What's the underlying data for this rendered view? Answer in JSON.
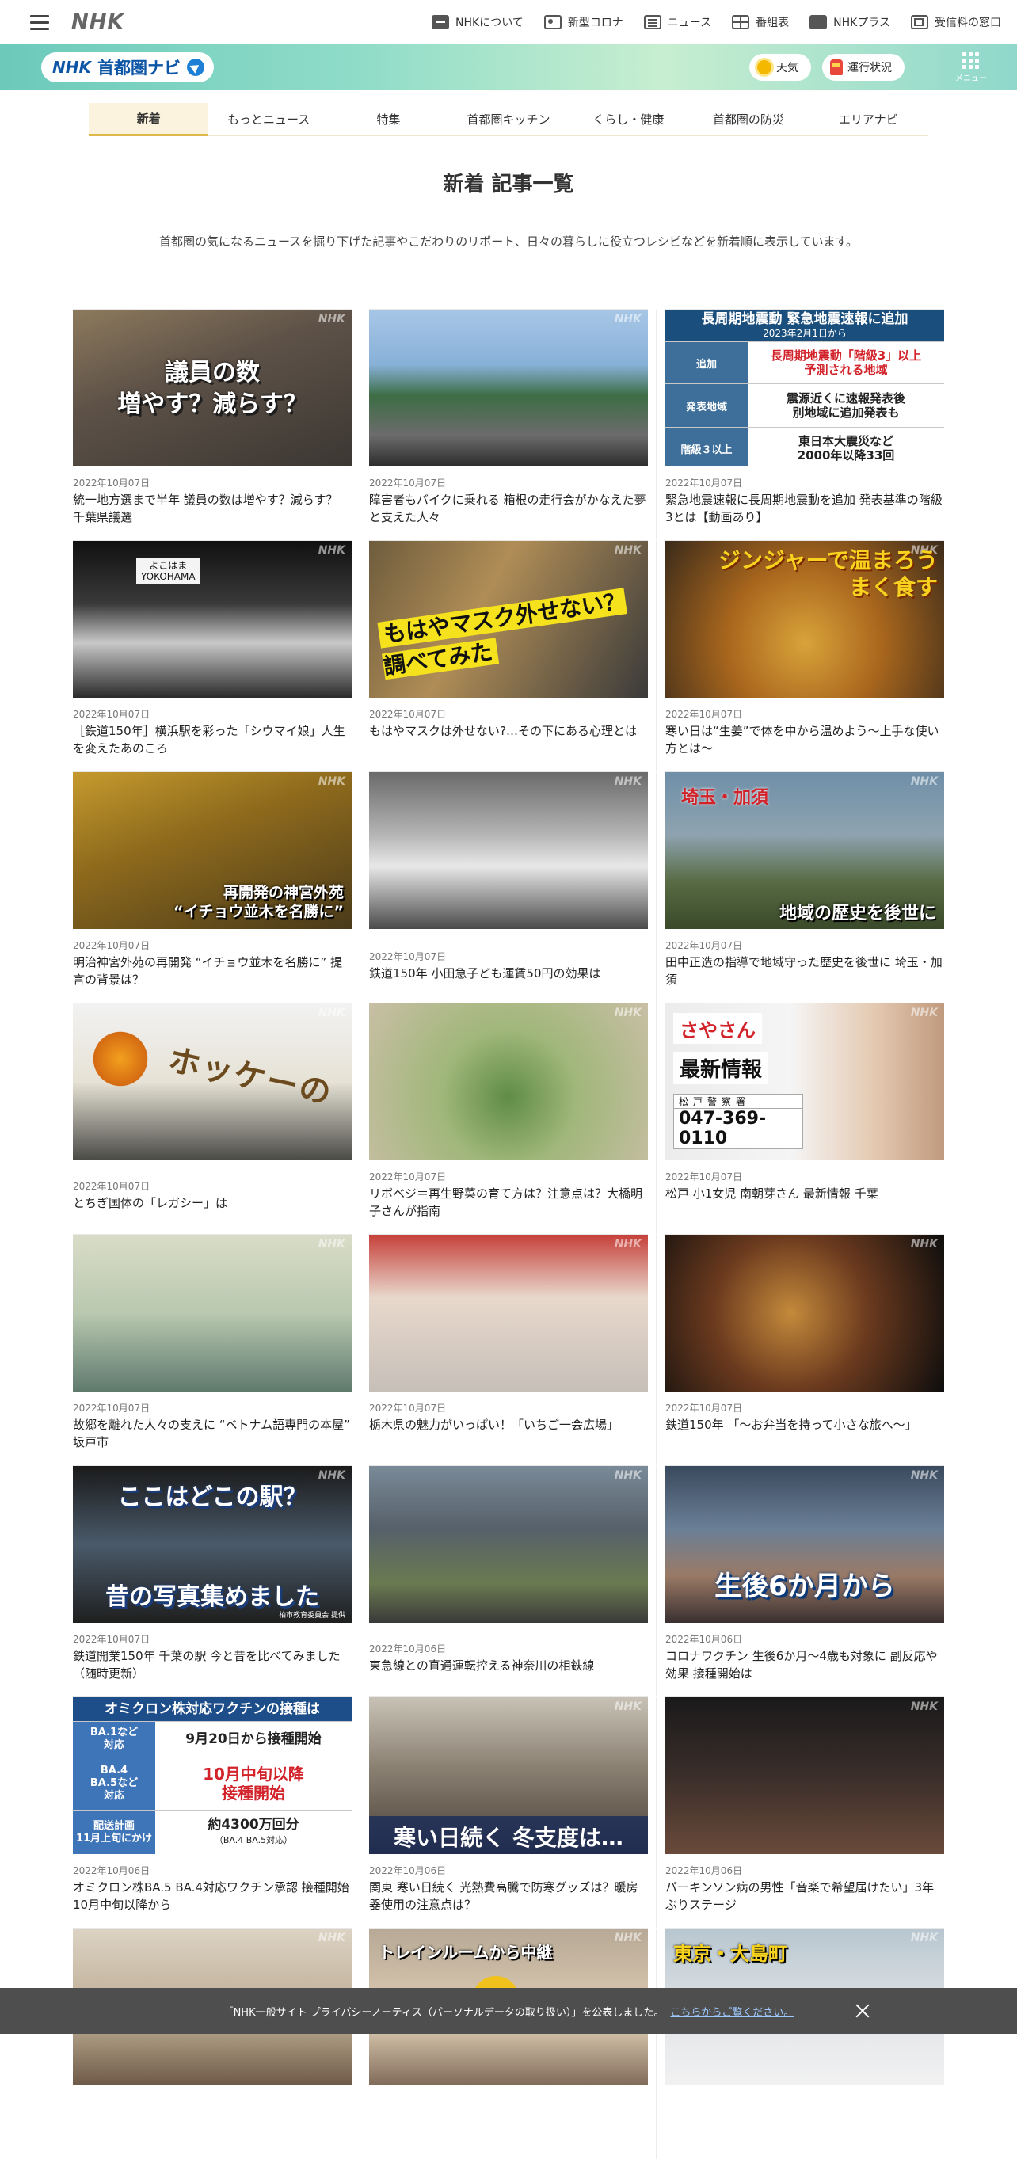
{
  "global_nav": {
    "logo": "NHK",
    "links": [
      {
        "label": "NHKについて",
        "icon": "nhk-icon"
      },
      {
        "label": "新型コロナ",
        "icon": "corona-icon"
      },
      {
        "label": "ニュース",
        "icon": "news-icon"
      },
      {
        "label": "番組表",
        "icon": "program-guide-icon"
      },
      {
        "label": "NHKプラス",
        "icon": "nhk-plus-icon"
      },
      {
        "label": "受信料の窓口",
        "icon": "license-fee-icon"
      }
    ]
  },
  "region_header": {
    "logo_nhk": "NHK",
    "logo_name": "首都圏ナビ",
    "weather_label": "天気",
    "traffic_label": "運行状況",
    "menu_label": "メニュー"
  },
  "tabs": [
    {
      "label": "新着",
      "active": true
    },
    {
      "label": "もっとニュース",
      "active": false
    },
    {
      "label": "特集",
      "active": false
    },
    {
      "label": "首都圏キッチン",
      "active": false
    },
    {
      "label": "くらし・健康",
      "active": false
    },
    {
      "label": "首都圏の防災",
      "active": false
    },
    {
      "label": "エリアナビ",
      "active": false
    }
  ],
  "page": {
    "title": "新着 記事一覧",
    "description": "首都圏の気になるニュースを掘り下げた記事やこだわりのリポート、日々の暮らしに役立つレシピなどを新着順に表示しています。"
  },
  "thumbnail_texts": {
    "watermark": "NHK",
    "giin": "議員の数\n増やす？減らす？",
    "eq_title": "長周期地震動 緊急地震速報に追加",
    "eq_date": "2023年2月1日から",
    "eq_rows": [
      {
        "key": "追加",
        "value": "長周期地震動「階級3」以上\n予測される地域"
      },
      {
        "key": "発表地域",
        "value": "震源近くに速報発表後\n別地域に追加発表も"
      },
      {
        "key": "階級３以上",
        "value": "東日本大震災など\n2000年以降33回"
      }
    ],
    "yokohama_sign": "よこはま\nYOKOHAMA",
    "mask": "もはやマスク外せない？\n調べてみた",
    "ginger": "ジンジャーで温まろう\nまく食す",
    "jingu": "再開発の神宮外苑\n“イチョウ並木を名勝に”",
    "saitama_title": "埼玉・加須",
    "saitama_caption": "地域の歴史を後世に",
    "hockey": "ホッケーの",
    "police_name": "さやさん",
    "police_info": "最新情報",
    "police_station": "松戸警察署",
    "police_tel": "047-369-0110",
    "eki_q": "ここはどこの駅？",
    "eki_a": "昔の写真集めました",
    "eki_credit": "柏市教育委員会 提供",
    "baby": "生後6か月から",
    "vx_title": "オミクロン株対応ワクチンの接種は",
    "vx_rows": [
      {
        "key": "BA.1など\n対応",
        "value": "9月20日から接種開始",
        "small": ""
      },
      {
        "key": "BA.4\nBA.5など\n対応",
        "value": "10月中旬以降\n接種開始",
        "small": ""
      },
      {
        "key": "配送計画\n11月上旬にかけ",
        "value": "約4300万回分",
        "small": "（BA.4 BA.5対応）"
      }
    ],
    "cold": "寒い日続く 冬支度は…",
    "trainroom": "トレインルームから中継",
    "oshima": "東京・大島町"
  },
  "articles": [
    {
      "date": "2022年10月07日",
      "title": "統一地方選まで半年 議員の数は増やす？減らす？ 千葉県議選"
    },
    {
      "date": "2022年10月07日",
      "title": "障害者もバイクに乗れる 箱根の走行会がかなえた夢と支えた人々"
    },
    {
      "date": "2022年10月07日",
      "title": "緊急地震速報に長周期地震動を追加 発表基準の階級3とは【動画あり】"
    },
    {
      "date": "2022年10月07日",
      "title": "［鉄道150年］横浜駅を彩った「シウマイ娘」人生を変えたあのころ"
    },
    {
      "date": "2022年10月07日",
      "title": "もはやマスクは外せない?…その下にある心理とは"
    },
    {
      "date": "2022年10月07日",
      "title": "寒い日は“生姜”で体を中から温めよう～上手な使い方とは～"
    },
    {
      "date": "2022年10月07日",
      "title": "明治神宮外苑の再開発 “イチョウ並木を名勝に” 提言の背景は？"
    },
    {
      "date": "2022年10月07日",
      "title": "鉄道150年 小田急子ども運賃50円の効果は"
    },
    {
      "date": "2022年10月07日",
      "title": "田中正造の指導で地域守った歴史を後世に 埼玉・加須"
    },
    {
      "date": "2022年10月07日",
      "title": "とちぎ国体の「レガシー」は"
    },
    {
      "date": "2022年10月07日",
      "title": "リボベジ＝再生野菜の育て方は？注意点は？大橋明子さんが指南"
    },
    {
      "date": "2022年10月07日",
      "title": "松戸 小1女児 南朝芽さん 最新情報 千葉"
    },
    {
      "date": "2022年10月07日",
      "title": "故郷を離れた人々の支えに “ベトナム語専門の本屋” 坂戸市"
    },
    {
      "date": "2022年10月07日",
      "title": "栃木県の魅力がいっぱい！「いちご一会広場」"
    },
    {
      "date": "2022年10月07日",
      "title": "鉄道150年 「～お弁当を持って小さな旅へ～」"
    },
    {
      "date": "2022年10月07日",
      "title": "鉄道開業150年 千葉の駅 今と昔を比べてみました（随時更新）"
    },
    {
      "date": "2022年10月06日",
      "title": "東急線との直通運転控える神奈川の相鉄線"
    },
    {
      "date": "2022年10月06日",
      "title": "コロナワクチン 生後6か月～4歳も対象に 副反応や効果 接種開始は"
    },
    {
      "date": "2022年10月06日",
      "title": "オミクロン株BA.5 BA.4対応ワクチン承認 接種開始10月中旬以降から"
    },
    {
      "date": "2022年10月06日",
      "title": "関東 寒い日続く 光熱費高騰で防寒グッズは？暖房器使用の注意点は？"
    },
    {
      "date": "2022年10月06日",
      "title": "パーキンソン病の男性「音楽で希望届けたい」3年ぶりステージ"
    },
    {
      "date": "",
      "title": ""
    },
    {
      "date": "",
      "title": ""
    },
    {
      "date": "",
      "title": ""
    }
  ],
  "cookie_banner": {
    "text": "「NHK一般サイト プライバシーノーティス（パーソナルデータの取り扱い）」を公表しました。",
    "link": "こちらからご覧ください。"
  }
}
